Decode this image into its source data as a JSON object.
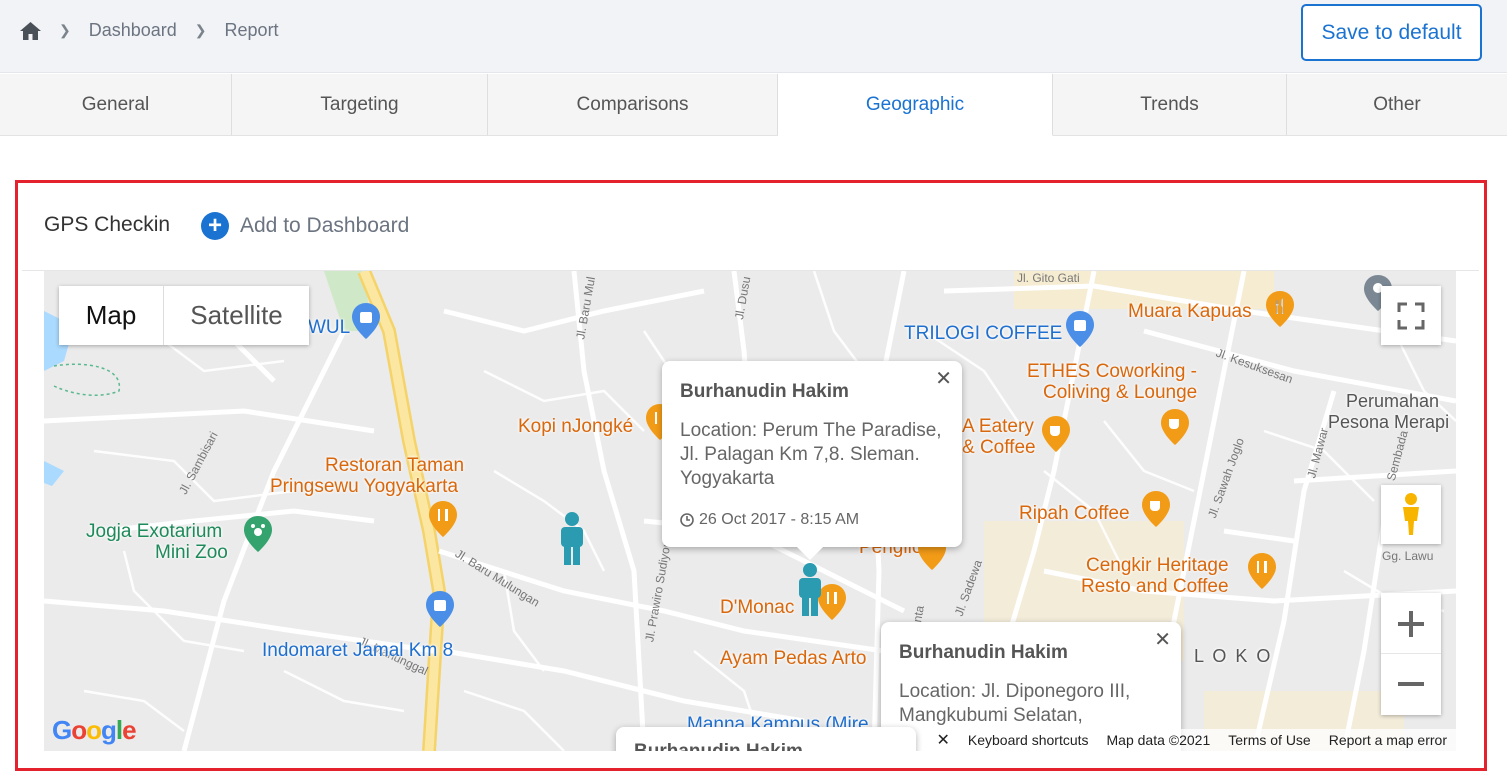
{
  "breadcrumb": {
    "home_icon": "home-icon",
    "items": [
      "Dashboard",
      "Report"
    ]
  },
  "header": {
    "save_label": "Save to default"
  },
  "tabs": [
    {
      "label": "General"
    },
    {
      "label": "Targeting"
    },
    {
      "label": "Comparisons"
    },
    {
      "label": "Geographic",
      "active": true
    },
    {
      "label": "Trends"
    },
    {
      "label": "Other"
    }
  ],
  "panel": {
    "title": "GPS Checkin",
    "add_label": "Add to Dashboard"
  },
  "map": {
    "type_map": "Map",
    "type_satellite": "Satellite",
    "places": {
      "muara": "Muara Kapuas",
      "trilogi": "TRILOGI COFFEE",
      "ethes1": "ETHES Coworking -",
      "ethes2": "Coliving & Lounge",
      "eatery1": "A Eatery",
      "eatery2": "& Coffee",
      "kopi": "Kopi nJongké",
      "restoran1": "Restoran Taman",
      "restoran2": "Pringsewu Yogyakarta",
      "jogja1": "Jogja Exotarium",
      "jogja2": "Mini Zoo",
      "indomaret": "Indomaret Jamal Km 8",
      "ripah": "Ripah Coffee",
      "cengkir1": "Cengkir Heritage",
      "cengkir2": "Resto and Coffee",
      "dmonaco": "D'Monac",
      "ayam": "Ayam Pedas Arto",
      "manna": "Manna Kampus (Mire",
      "perumahan1": "Perumahan",
      "perumahan2": "Pesona Merapi",
      "penglion": "Penglion",
      "loko": "L O K O",
      "wul": "WUL"
    },
    "roads": {
      "gito": "Jl. Gito Gati",
      "kesuksesan": "Jl. Kesuksesan",
      "sambisari": "Jl. Sambisari",
      "mulungan": "Jl. Baru Mulungan",
      "manunggal": "Jl. Manunggal",
      "prawiro": "Jl. Prawiro Sudiyono",
      "sawah": "Jl. Sawah Joglo",
      "mawar": "Jl. Mawar",
      "sembada": "Jl. Sembada",
      "sadewa": "Jl. Sadewa",
      "shinta": "Jl. Shinta",
      "lawu": "Gg. Lawu",
      "baru_mul": "Jl. Baru Mul",
      "dusu": "Jl. Dusu"
    },
    "footer": {
      "shortcuts": "Keyboard shortcuts",
      "mapdata": "Map data ©2021",
      "terms": "Terms of Use",
      "report": "Report a map error"
    },
    "logo": "Google"
  },
  "popups": [
    {
      "name": "Burhanudin Hakim",
      "location": "Location: Perum The Paradise, Jl. Palagan Km 7,8. Sleman. Yogyakarta",
      "date": "26 Oct 2017 - 8:15 AM"
    },
    {
      "name": "Burhanudin Hakim",
      "location": "Location: Jl. Diponegoro III, Mangkubumi Selatan,"
    },
    {
      "name": "Burhanudin Hakim"
    }
  ]
}
